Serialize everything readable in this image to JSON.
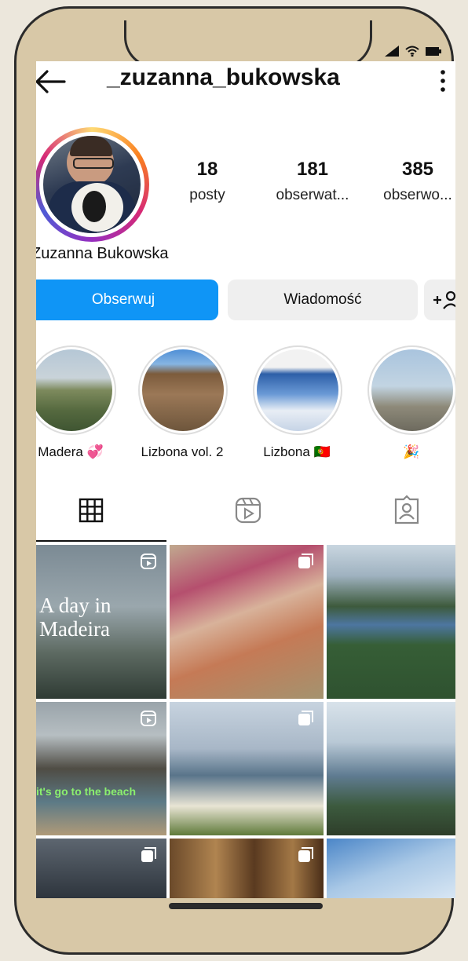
{
  "header": {
    "username": "_zuzanna_bukowska"
  },
  "profile": {
    "full_name": "Zuzanna Bukowska",
    "stats": [
      {
        "num": "18",
        "label": "posty"
      },
      {
        "num": "181",
        "label": "obserwat..."
      },
      {
        "num": "385",
        "label": "obserwo..."
      }
    ]
  },
  "actions": {
    "follow": "Obserwuj",
    "message": "Wiadomość",
    "add_user": "+♀"
  },
  "highlights": [
    {
      "label": "Madera 💞"
    },
    {
      "label": "Lizbona vol. 2"
    },
    {
      "label": "Lizbona 🇵🇹"
    },
    {
      "label": "🎉"
    }
  ],
  "posts": [
    {
      "caption": "A day in Madeira",
      "type": "reel"
    },
    {
      "caption": "",
      "type": "carousel"
    },
    {
      "caption": "",
      "type": "carousel"
    },
    {
      "caption": "it's go to the beach",
      "type": "reel"
    },
    {
      "caption": "",
      "type": "carousel"
    },
    {
      "caption": "",
      "type": "carousel"
    },
    {
      "caption": "",
      "type": "carousel"
    },
    {
      "caption": "",
      "type": "carousel"
    },
    {
      "caption": "",
      "type": "carousel"
    }
  ],
  "colors": {
    "follow_button": "#0f95f6",
    "frame": "#d8c8a7"
  }
}
